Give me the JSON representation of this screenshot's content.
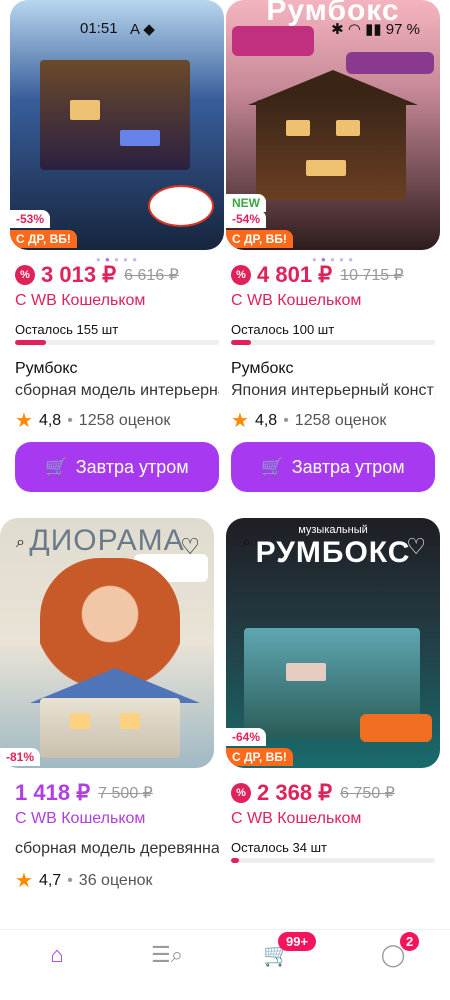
{
  "status": {
    "time": "01:51",
    "battery": "97 %"
  },
  "products": [
    {
      "image_title": "",
      "discount": "-53%",
      "promo": "С ДР, ВБ!",
      "new": "",
      "price": "3 013 ₽",
      "old_price": "6 616 ₽",
      "wallet": "С WB Кошельком",
      "stock_left": "Осталось 155 шт",
      "brand": "Румбокс",
      "title": "сборная модель интерьерная",
      "rating": "4,8",
      "reviews": "1258 оценок",
      "cta": "Завтра утром"
    },
    {
      "image_title": "Румбокс",
      "discount": "-54%",
      "promo": "С ДР, ВБ!",
      "new": "NEW",
      "price": "4 801 ₽",
      "old_price": "10 715 ₽",
      "wallet": "С WB Кошельком",
      "stock_left": "Осталось 100 шт",
      "brand": "Румбокс",
      "title": "Япония интерьерный конструктор",
      "rating": "4,8",
      "reviews": "1258 оценок",
      "cta": "Завтра утром"
    },
    {
      "image_title": "ДИОРАМА",
      "discount": "-81%",
      "promo": "",
      "price": "1 418 ₽",
      "old_price": "7 500 ₽",
      "wallet": "С WB Кошельком",
      "title": "сборная модель деревянная",
      "rating": "4,7",
      "reviews": "36 оценок"
    },
    {
      "image_title": "РУМБОКС",
      "image_sub": "музыкальный",
      "discount": "-64%",
      "promo": "С ДР, ВБ!",
      "price": "2 368 ₽",
      "old_price": "6 750 ₽",
      "wallet": "С WB Кошельком",
      "stock_left": "Осталось 34 шт"
    }
  ],
  "tabbar": {
    "cart_count": "99+",
    "profile_count": "2"
  }
}
